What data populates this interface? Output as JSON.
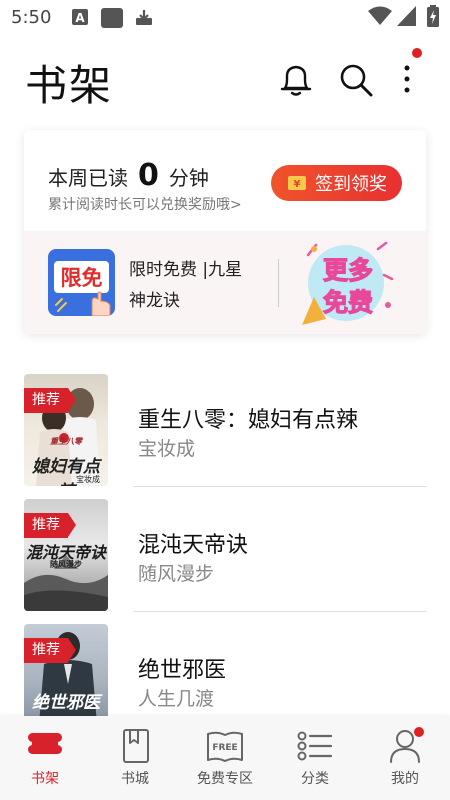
{
  "status_bar": {
    "time": "5:50"
  },
  "header": {
    "title": "书架"
  },
  "reading": {
    "label": "本周已读",
    "minutes": "0",
    "unit": "分钟",
    "subtitle": "累计阅读时长可以兑换奖励哦>",
    "checkin_label": "签到领奖"
  },
  "free_promo": {
    "badge_text": "限免",
    "title": "限时免费 |九星神龙诀",
    "more_free_text_1": "更多",
    "more_free_text_2": "免费"
  },
  "books": [
    {
      "tag": "推荐",
      "title": "重生八零：媳妇有点辣",
      "author": "宝妆成",
      "cover_text": "媳妇有点辣",
      "cover_small": "重生八零",
      "cover_author": "宝妆成"
    },
    {
      "tag": "推荐",
      "title": "混沌天帝诀",
      "author": "随风漫步",
      "cover_text": "混沌天帝诀",
      "cover_small": "随风漫步"
    },
    {
      "tag": "推荐",
      "title": "绝世邪医",
      "author": "人生几渡",
      "cover_text": "绝世邪医"
    }
  ],
  "nav": {
    "items": [
      {
        "label": "书架",
        "icon": "bookshelf-icon",
        "active": true
      },
      {
        "label": "书城",
        "icon": "book-icon"
      },
      {
        "label": "免费专区",
        "icon": "free-book-icon",
        "icon_text": "FREE"
      },
      {
        "label": "分类",
        "icon": "category-list-icon"
      },
      {
        "label": "我的",
        "icon": "profile-icon"
      }
    ]
  },
  "colors": {
    "accent": "#d7222b",
    "checkin_gradient_start": "#f0542c",
    "checkin_gradient_end": "#e83030",
    "badge_blue": "#3a6fe0",
    "notification_dot": "#e02020"
  }
}
